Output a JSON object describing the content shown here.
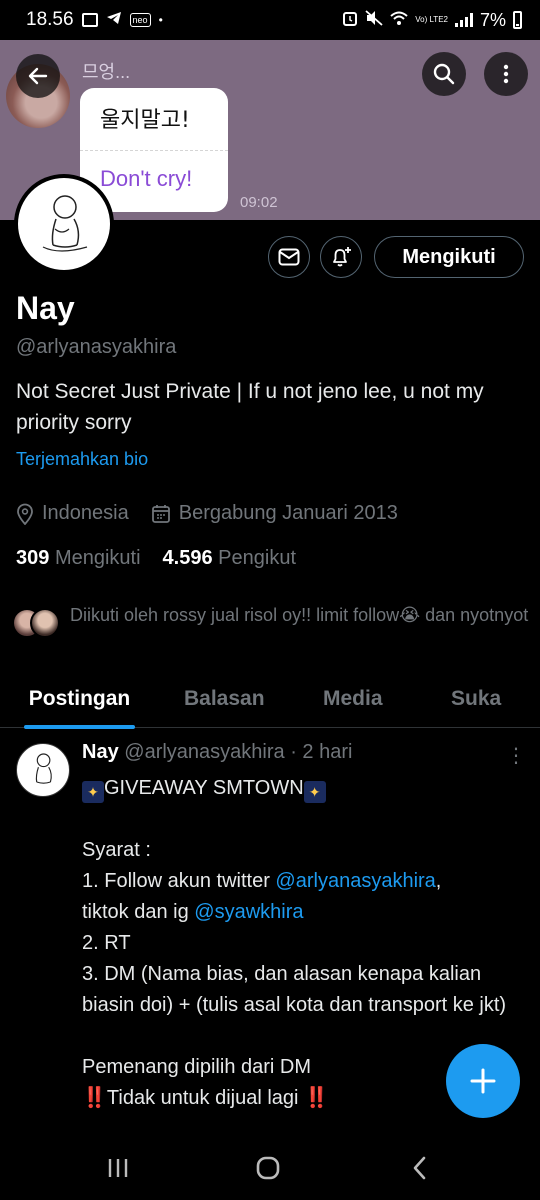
{
  "status_bar": {
    "time": "18.56",
    "neo_label": "neo",
    "dot": "•",
    "lte": "Vo) LTE2",
    "battery": "7%"
  },
  "banner": {
    "chat_name": "므엉...",
    "bubble_korean": "울지말고!",
    "bubble_english": "Don't cry!",
    "bubble_time": "09:02"
  },
  "profile": {
    "name": "Nay",
    "handle": "@arlyanasyakhira",
    "bio": "Not Secret Just Private | If u not jeno lee, u not my priority sorry",
    "translate_link": "Terjemahkan bio",
    "location": "Indonesia",
    "joined": "Bergabung Januari 2013",
    "following_count": "309",
    "following_label": "Mengikuti",
    "followers_count": "4.596",
    "followers_label": "Pengikut",
    "followed_by": "Diikuti oleh rossy jual risol oy!! limit follow😭 dan nyotnyot",
    "follow_button": "Mengikuti"
  },
  "tabs": [
    {
      "label": "Postingan",
      "active": true
    },
    {
      "label": "Balasan",
      "active": false
    },
    {
      "label": "Media",
      "active": false
    },
    {
      "label": "Suka",
      "active": false
    }
  ],
  "post": {
    "author": "Nay",
    "handle_time": "@arlyanasyakhira · 2 hari",
    "more": "⋮",
    "title": "GIVEAWAY SMTOWN",
    "syarat": "Syarat :",
    "line1_a": "1. Follow akun twitter ",
    "line1_link": "@arlyanasyakhira",
    "line1_b": ",",
    "line2_a": "tiktok dan ig ",
    "line2_link": "@syawkhira",
    "line3": "2. RT",
    "line4": "3. DM (Nama bias, dan alasan kenapa kalian biasin doi) + (tulis asal kota dan transport ke jkt)",
    "winner": "Pemenang dipilih dari DM",
    "not_for_sale": "Tidak untuk dijual lagi",
    "bang": "‼️"
  },
  "colors": {
    "accent": "#1d9bf0",
    "banner": "#7d6a81",
    "muted": "#71767b"
  }
}
